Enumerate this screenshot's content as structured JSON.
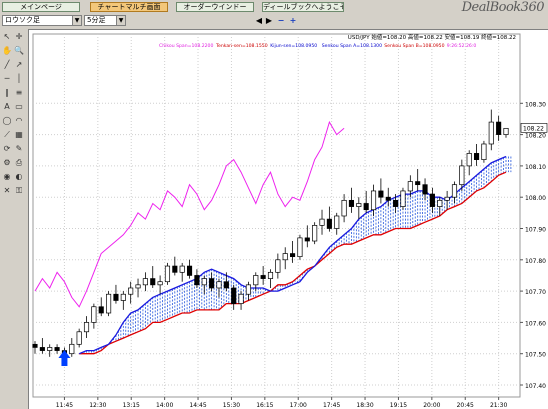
{
  "tabs": [
    {
      "label": "メインページ",
      "active": false
    },
    {
      "label": "チャートマルチ画面",
      "active": true
    },
    {
      "label": "オーダーウインドー",
      "active": false
    },
    {
      "label": "ディールブックへようこそ",
      "active": false
    }
  ],
  "logo": "DealBook360",
  "toolbar": {
    "chart_type": "ロウソク足",
    "period": "5分足",
    "zoom_in": "+",
    "zoom_out": "−",
    "nav_left": "◀",
    "nav_right": "▶"
  },
  "info": {
    "ohlc": "USD/JPY 始値=108.20 高値=108.22 安値=108.19 終値=108.22",
    "ichimoku": [
      {
        "text": "Chikou Span=108.2200",
        "color": "#e020e0"
      },
      {
        "text": "Tenkan-sen=108.1550",
        "color": "#cc0000"
      },
      {
        "text": "Kijun-sen=108.0950",
        "color": "#0000cc"
      },
      {
        "text": "Senkou Span A=108.1300",
        "color": "#0000cc"
      },
      {
        "text": "Senkou Span B=108.0950",
        "color": "#cc0000"
      },
      {
        "text": "9:26:52:26:0",
        "color": "#e020e0"
      }
    ]
  },
  "chart_data": {
    "type": "candlestick",
    "symbol": "USD/JPY",
    "timeframe": "5分足",
    "ylim": [
      107.4,
      108.4
    ],
    "y_ticks": [
      "108.30",
      "108.20",
      "108.10",
      "108.00",
      "107.90",
      "107.80",
      "107.70",
      "107.60",
      "107.50",
      "107.40"
    ],
    "x_ticks": [
      "11:45",
      "12:30",
      "13:15",
      "14:00",
      "14:45",
      "15:30",
      "16:15",
      "17:00",
      "17:45",
      "18:30",
      "19:15",
      "20:00",
      "20:45",
      "21:30"
    ],
    "last_price": "108.22",
    "candles": [
      [
        107.53,
        107.54,
        107.5,
        107.52
      ],
      [
        107.52,
        107.55,
        107.5,
        107.51
      ],
      [
        107.51,
        107.53,
        107.49,
        107.52
      ],
      [
        107.52,
        107.53,
        107.5,
        107.51
      ],
      [
        107.51,
        107.52,
        107.49,
        107.5
      ],
      [
        107.5,
        107.55,
        107.49,
        107.53
      ],
      [
        107.53,
        107.58,
        107.52,
        107.57
      ],
      [
        107.57,
        107.62,
        107.55,
        107.6
      ],
      [
        107.6,
        107.66,
        107.58,
        107.65
      ],
      [
        107.65,
        107.68,
        107.62,
        107.63
      ],
      [
        107.63,
        107.7,
        107.62,
        107.69
      ],
      [
        107.69,
        107.72,
        107.66,
        107.67
      ],
      [
        107.67,
        107.7,
        107.64,
        107.69
      ],
      [
        107.69,
        107.73,
        107.66,
        107.71
      ],
      [
        107.71,
        107.74,
        107.68,
        107.72
      ],
      [
        107.72,
        107.76,
        107.7,
        107.74
      ],
      [
        107.74,
        107.78,
        107.71,
        107.72
      ],
      [
        107.72,
        107.75,
        107.69,
        107.73
      ],
      [
        107.73,
        107.79,
        107.72,
        107.78
      ],
      [
        107.78,
        107.81,
        107.75,
        107.76
      ],
      [
        107.76,
        107.79,
        107.73,
        107.78
      ],
      [
        107.78,
        107.8,
        107.74,
        107.75
      ],
      [
        107.75,
        107.77,
        107.71,
        107.72
      ],
      [
        107.72,
        107.75,
        107.69,
        107.74
      ],
      [
        107.74,
        107.76,
        107.7,
        107.71
      ],
      [
        107.71,
        107.74,
        107.68,
        107.73
      ],
      [
        107.73,
        107.76,
        107.7,
        107.71
      ],
      [
        107.71,
        107.72,
        107.64,
        107.66
      ],
      [
        107.66,
        107.7,
        107.64,
        107.69
      ],
      [
        107.69,
        107.73,
        107.67,
        107.72
      ],
      [
        107.72,
        107.76,
        107.7,
        107.75
      ],
      [
        107.75,
        107.78,
        107.72,
        107.74
      ],
      [
        107.74,
        107.77,
        107.71,
        107.76
      ],
      [
        107.76,
        107.82,
        107.74,
        107.8
      ],
      [
        107.8,
        107.84,
        107.77,
        107.82
      ],
      [
        107.82,
        107.86,
        107.79,
        107.81
      ],
      [
        107.81,
        107.88,
        107.8,
        107.87
      ],
      [
        107.87,
        107.91,
        107.84,
        107.86
      ],
      [
        107.86,
        107.92,
        107.85,
        107.91
      ],
      [
        107.91,
        107.96,
        107.88,
        107.93
      ],
      [
        107.93,
        107.97,
        107.89,
        107.9
      ],
      [
        107.9,
        107.95,
        107.88,
        107.94
      ],
      [
        107.94,
        108.01,
        107.92,
        107.99
      ],
      [
        107.99,
        108.03,
        107.95,
        107.97
      ],
      [
        107.97,
        108.0,
        107.93,
        107.98
      ],
      [
        107.98,
        108.02,
        107.95,
        107.96
      ],
      [
        107.96,
        108.04,
        107.94,
        108.02
      ],
      [
        108.02,
        108.06,
        107.98,
        108.0
      ],
      [
        108.0,
        108.03,
        107.97,
        107.99
      ],
      [
        107.99,
        108.01,
        107.95,
        107.97
      ],
      [
        107.97,
        108.03,
        107.96,
        108.02
      ],
      [
        108.02,
        108.07,
        108.0,
        108.05
      ],
      [
        108.05,
        108.09,
        108.02,
        108.04
      ],
      [
        108.04,
        108.06,
        107.99,
        108.01
      ],
      [
        108.01,
        108.03,
        107.95,
        107.97
      ],
      [
        107.97,
        108.0,
        107.94,
        107.99
      ],
      [
        107.99,
        108.02,
        107.96,
        108.0
      ],
      [
        108.0,
        108.05,
        107.98,
        108.04
      ],
      [
        108.04,
        108.12,
        108.02,
        108.1
      ],
      [
        108.1,
        108.15,
        108.07,
        108.14
      ],
      [
        108.14,
        108.17,
        108.1,
        108.12
      ],
      [
        108.12,
        108.18,
        108.11,
        108.17
      ],
      [
        108.17,
        108.28,
        108.15,
        108.24
      ],
      [
        108.24,
        108.26,
        108.18,
        108.2
      ],
      [
        108.2,
        108.22,
        108.19,
        108.22
      ]
    ],
    "chikou": [
      107.7,
      107.74,
      107.71,
      107.76,
      107.73,
      107.68,
      107.65,
      107.7,
      107.76,
      107.82,
      107.84,
      107.86,
      107.88,
      107.91,
      107.95,
      107.93,
      107.98,
      107.96,
      108.02,
      108.0,
      107.97,
      108.04,
      108.01,
      107.96,
      107.99,
      108.04,
      108.1,
      108.12,
      108.08,
      108.03,
      107.98,
      108.04,
      108.08,
      108.01,
      107.97,
      108.0,
      107.99,
      108.05,
      108.12,
      108.16,
      108.24,
      108.2,
      108.22
    ],
    "tenkan": [
      107.5,
      107.51,
      107.51,
      107.52,
      107.53,
      107.56,
      107.6,
      107.63,
      107.64,
      107.66,
      107.68,
      107.69,
      107.7,
      107.71,
      107.72,
      107.73,
      107.74,
      107.76,
      107.77,
      107.76,
      107.75,
      107.74,
      107.72,
      107.71,
      107.71,
      107.71,
      107.7,
      107.7,
      107.71,
      107.72,
      107.73,
      107.76,
      107.78,
      107.81,
      107.84,
      107.86,
      107.88,
      107.9,
      107.93,
      107.95,
      107.96,
      107.97,
      107.99,
      108.0,
      108.01,
      108.01,
      108.02,
      108.02,
      108.0,
      108.0,
      107.99,
      108.01,
      108.03,
      108.05,
      108.07,
      108.09,
      108.11,
      108.12,
      108.13
    ],
    "kijun": [
      107.5,
      107.5,
      107.5,
      107.51,
      107.53,
      107.55,
      107.57,
      107.6,
      107.62,
      107.64,
      107.65,
      107.66,
      107.67,
      107.68,
      107.68,
      107.7,
      107.71,
      107.72,
      107.73,
      107.73,
      107.73,
      107.72,
      107.72,
      107.72,
      107.72,
      107.71,
      107.71,
      107.72,
      107.73,
      107.75,
      107.78,
      107.8,
      107.82,
      107.85,
      107.87,
      107.89,
      107.91,
      107.92,
      107.94,
      107.95,
      107.96,
      107.97,
      107.97,
      107.98,
      107.98,
      107.98,
      107.98,
      107.99,
      108.0,
      108.01,
      108.02,
      108.04,
      108.05,
      108.06,
      108.07,
      108.08,
      108.09,
      108.09,
      108.1
    ],
    "senkou_b": [
      107.5,
      107.5,
      107.5,
      107.51,
      107.53,
      107.54,
      107.55,
      107.56,
      107.57,
      107.58,
      107.6,
      107.6,
      107.61,
      107.62,
      107.63,
      107.63,
      107.64,
      107.64,
      107.64,
      107.64,
      107.66,
      107.66,
      107.66,
      107.67,
      107.68,
      107.69,
      107.7,
      107.72,
      107.72,
      107.73,
      107.75,
      107.77,
      107.78,
      107.8,
      107.82,
      107.84,
      107.85,
      107.85,
      107.86,
      107.87,
      107.88,
      107.88,
      107.89,
      107.9,
      107.9,
      107.9,
      107.91,
      107.92,
      107.93,
      107.94,
      107.96,
      107.97,
      107.98,
      108.0,
      108.02,
      108.03,
      108.05,
      108.07,
      108.08
    ]
  },
  "colors": {
    "chikou": "#ee22ee",
    "kumo_fill": "#2255dd",
    "tenkan": "#1a1adf",
    "senkou_b": "#e00000",
    "candle_up": "#ffffff",
    "candle_down": "#000000",
    "arrow": "#0040ff"
  },
  "left_tools": [
    "cursor-icon",
    "crosshair-icon",
    "hand-icon",
    "magnify-icon",
    "trendline-icon",
    "ray-icon",
    "hline-icon",
    "vline-icon",
    "channel-icon",
    "fib-icon",
    "text-icon",
    "rectangle-icon",
    "ellipse-icon",
    "arc-icon",
    "fan-icon",
    "grid-icon",
    "cycle-icon",
    "eraser-icon",
    "settings-icon",
    "print-icon",
    "eye-icon",
    "palette-icon",
    "delete-icon",
    "lock-icon"
  ]
}
